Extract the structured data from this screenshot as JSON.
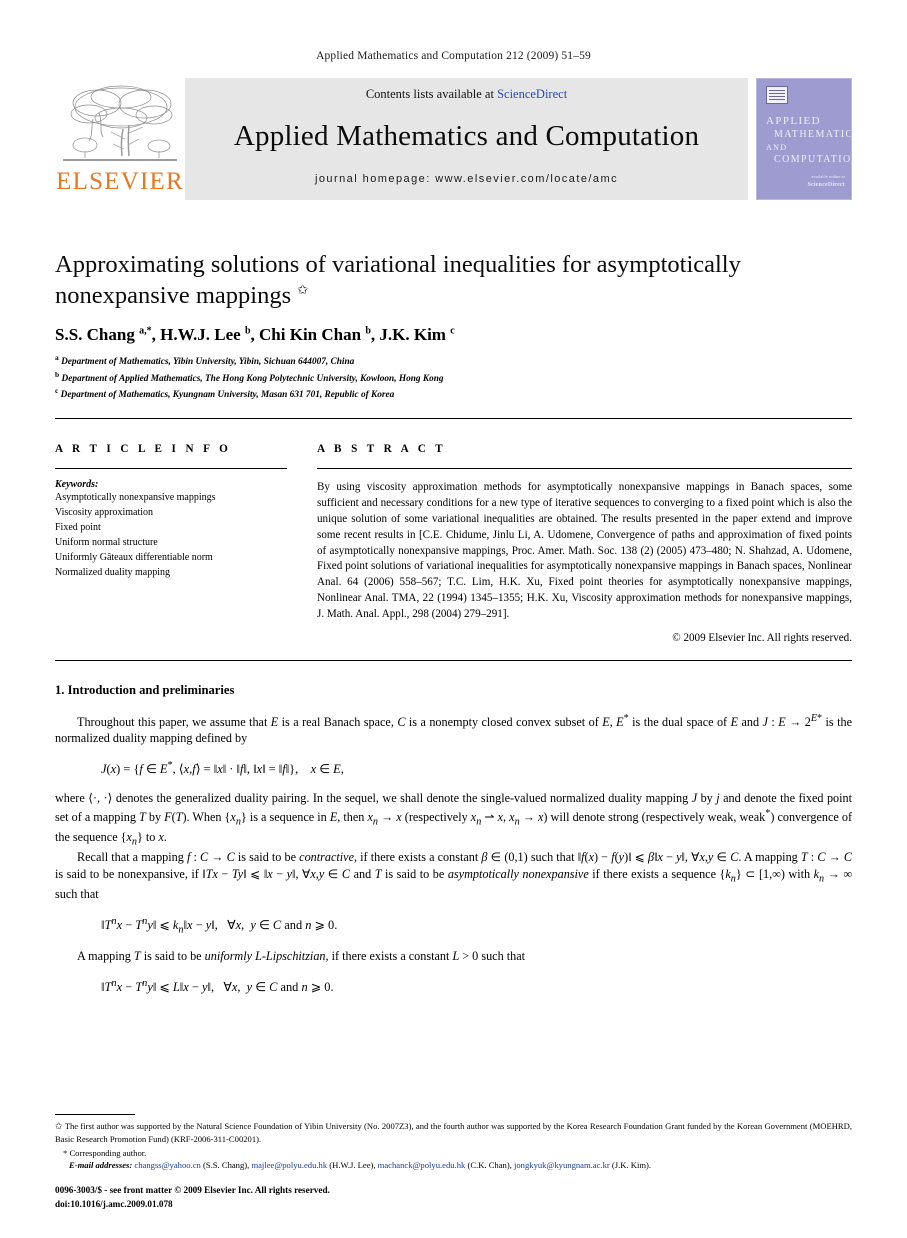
{
  "running_head": "Applied Mathematics and Computation 212 (2009) 51–59",
  "masthead": {
    "contents_prefix": "Contents lists available at ",
    "contents_link": "ScienceDirect",
    "journal_title": "Applied Mathematics and Computation",
    "homepage": "journal homepage: www.elsevier.com/locate/amc",
    "publisher_logo_text": "ELSEVIER",
    "cover": {
      "line1": "APPLIED",
      "line2": "MATHEMATICS",
      "line3": "AND",
      "line4": "COMPUTATION",
      "footer_small": "available online at",
      "footer_brand": "ScienceDirect"
    },
    "link_color": "#2b49a8",
    "band_color": "#e6e6e6",
    "cover_color": "#9d9bd0",
    "elsevier_orange": "#E87722"
  },
  "article": {
    "title": "Approximating solutions of variational inequalities for asymptotically nonexpansive mappings",
    "title_marker": "✩",
    "authors_html": "S.S. Chang <sup>a,</sup><sup>*</sup>, H.W.J. Lee <sup>b</sup>, Chi Kin Chan <sup>b</sup>, J.K. Kim <sup>c</sup>",
    "affiliations": [
      {
        "marker": "a",
        "text": "Department of Mathematics, Yibin University, Yibin, Sichuan 644007, China"
      },
      {
        "marker": "b",
        "text": "Department of Applied Mathematics, The Hong Kong Polytechnic University, Kowloon, Hong Kong"
      },
      {
        "marker": "c",
        "text": "Department of Mathematics, Kyungnam University, Masan 631 701, Republic of Korea"
      }
    ]
  },
  "info": {
    "heading": "A R T I C L E   I N F O",
    "keywords_label": "Keywords:",
    "keywords": [
      "Asymptotically nonexpansive mappings",
      "Viscosity approximation",
      "Fixed point",
      "Uniform normal structure",
      "Uniformly Gâteaux differentiable norm",
      "Normalized duality mapping"
    ]
  },
  "abstract": {
    "heading": "A B S T R A C T",
    "body": "By using viscosity approximation methods for asymptotically nonexpansive mappings in Banach spaces, some sufficient and necessary conditions for a new type of iterative sequences to converging to a fixed point which is also the unique solution of some variational inequalities are obtained. The results presented in the paper extend and improve some recent results in [C.E. Chidume, Jinlu Li, A. Udomene, Convergence of paths and approximation of fixed points of asymptotically nonexpansive mappings, Proc. Amer. Math. Soc. 138 (2) (2005) 473–480; N. Shahzad, A. Udomene, Fixed point solutions of variational inequalities for asymptotically nonexpansive mappings in Banach spaces, Nonlinear Anal. 64 (2006) 558–567; T.C. Lim, H.K. Xu, Fixed point theories for asymptotically nonexpansive mappings, Nonlinear Anal. TMA, 22 (1994) 1345–1355; H.K. Xu, Viscosity approximation methods for nonexpansive mappings, J. Math. Anal. Appl., 298 (2004) 279–291].",
    "copyright": "© 2009 Elsevier Inc. All rights reserved."
  },
  "section1": {
    "heading": "1. Introduction and preliminaries",
    "para1_html": "Throughout this paper, we assume that <i>E</i> is a real Banach space, <i>C</i> is a nonempty closed convex subset of <i>E</i>, <i>E</i><sup>*</sup> is the dual space of <i>E</i> and <i>J</i> : <i>E</i> → 2<sup><i>E</i>*</sup> is the normalized duality mapping defined by",
    "equation1_html": "<i>J</i>(<i>x</i>) = {<i>f</i> ∈ <i>E</i><sup>*</sup>, ⟨<i>x</i>,<i>f</i>⟩ = ‖<i>x</i>‖ · ‖<i>f</i>‖, ‖<i>x</i>‖ = ‖<i>f</i>‖},&nbsp;&nbsp;&nbsp; <i>x</i> ∈ <i>E</i>,",
    "para2_html": "where ⟨·, ·⟩ denotes the generalized duality pairing. In the sequel, we shall denote the single-valued normalized duality mapping <i>J</i> by <i>j</i> and denote the fixed point set of a mapping <i>T</i> by <i>F</i>(<i>T</i>). When {<i>x<sub>n</sub></i>} is a sequence in <i>E</i>, then <i>x<sub>n</sub></i> → <i>x</i> (respectively <i>x<sub>n</sub></i> ⇀ <i>x</i>, <i>x<sub>n</sub></i> → <i>x</i>) will denote strong (respectively weak, weak<sup>*</sup>) convergence of the sequence {<i>x<sub>n</sub></i>} to <i>x</i>.",
    "para3_html": "Recall that a mapping <i>f</i> : <i>C</i> → <i>C</i> is said to be <i>contractive</i>, if there exists a constant <i>β</i> ∈ (0,1) such that ‖<i>f</i>(<i>x</i>) − <i>f</i>(<i>y</i>)‖ ⩽ <i>β</i>‖<i>x</i> − <i>y</i>‖, ∀<i>x</i>,<i>y</i> ∈ <i>C</i>. A mapping <i>T</i> : <i>C</i> → <i>C</i> is said to be nonexpansive, if ‖<i>Tx</i> − <i>Ty</i>‖ ⩽ ‖<i>x</i> − <i>y</i>‖, ∀<i>x</i>,<i>y</i> ∈ <i>C</i> and <i>T</i> is said to be <i>asymptotically nonexpansive</i> if there exists a sequence {<i>k<sub>n</sub></i>} ⊂ [1,∞) with <i>k<sub>n</sub></i> → ∞ such that",
    "equation2_html": "‖<i>T<sup>n</sup>x</i> − <i>T<sup>n</sup>y</i>‖ ⩽ <i>k<sub>n</sub></i>‖<i>x</i> − <i>y</i>‖,&nbsp;&nbsp; ∀<i>x</i>, &nbsp;<i>y</i> ∈ <i>C</i> and <i>n</i> ⩾ 0.",
    "para4_html": "A mapping <i>T</i> is said to be <i>uniformly L-Lipschitzian</i>, if there exists a constant <i>L</i> &gt; 0 such that",
    "equation3_html": "‖<i>T<sup>n</sup>x</i> − <i>T<sup>n</sup>y</i>‖ ⩽ <i>L</i>‖<i>x</i> − <i>y</i>‖,&nbsp;&nbsp; ∀<i>x</i>, &nbsp;<i>y</i> ∈ <i>C</i> and <i>n</i> ⩾ 0."
  },
  "footnotes": {
    "funding_marker": "✩",
    "funding": "The first author was supported by the Natural Science Foundation of Yibin University (No. 2007Z3), and the fourth author was supported by the Korea Research Foundation Grant funded by the Korean Government (MOEHRD, Basic Research Promotion Fund) (KRF-2006-311-C00201).",
    "corresponding_marker": "*",
    "corresponding": "Corresponding author.",
    "email_label": "E-mail addresses:",
    "emails": [
      {
        "address": "changss@yahoo.cn",
        "person": "(S.S. Chang)"
      },
      {
        "address": "majlee@polyu.edu.hk",
        "person": "(H.W.J. Lee)"
      },
      {
        "address": "machanck@polyu.edu.hk",
        "person": "(C.K. Chan)"
      },
      {
        "address": "jongkyuk@kyungnam.ac.kr",
        "person": "(J.K. Kim)"
      }
    ],
    "issn_line": "0096-3003/$ - see front matter © 2009 Elsevier Inc. All rights reserved.",
    "doi_line": "doi:10.1016/j.amc.2009.01.078"
  }
}
